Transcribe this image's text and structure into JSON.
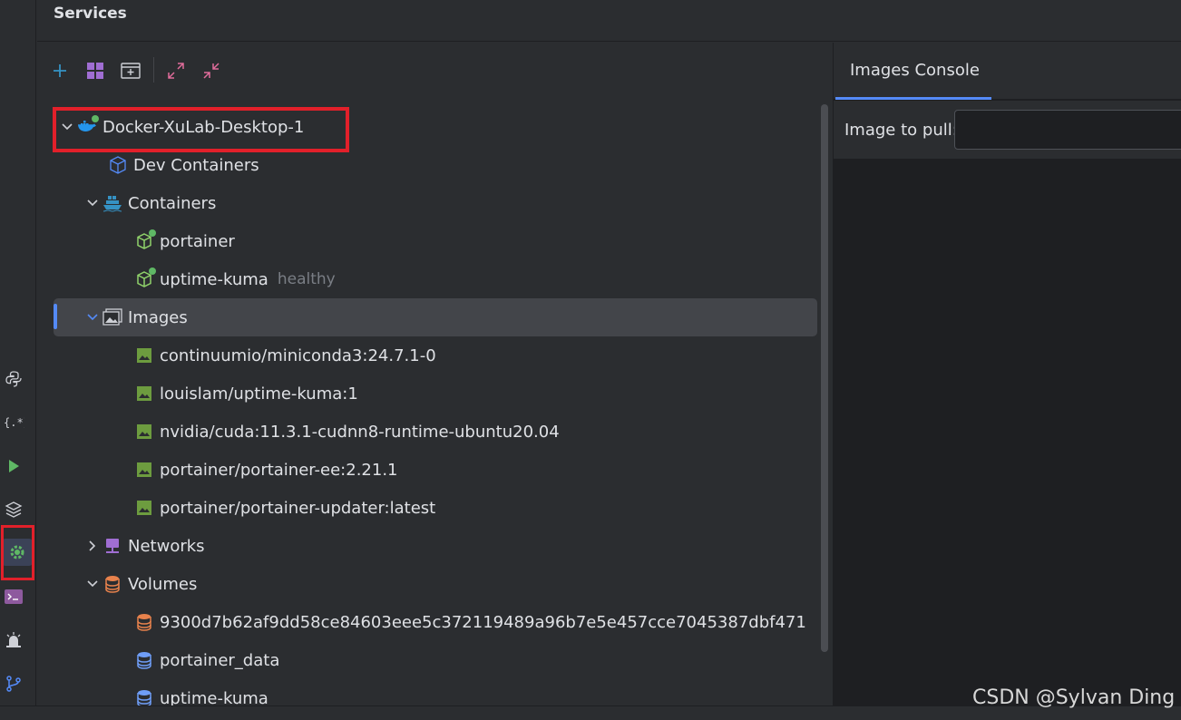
{
  "panel": {
    "title": "Services"
  },
  "toolbar": {
    "add": "add-icon",
    "group": "group-icon",
    "new_tab": "new-tab-icon",
    "expand": "expand-all-icon",
    "collapse": "collapse-all-icon"
  },
  "leftbar": {
    "items": [
      "python-icon",
      "regex-icon",
      "run-icon",
      "layers-icon",
      "services-gear-icon",
      "terminal-icon",
      "problems-icon",
      "git-icon"
    ],
    "active": "services-gear-icon"
  },
  "tree": {
    "root": {
      "label": "Docker-XuLab-Desktop-1",
      "status": "connected"
    },
    "dev_containers": {
      "label": "Dev Containers"
    },
    "containers": {
      "label": "Containers",
      "items": [
        {
          "label": "portainer",
          "hint": ""
        },
        {
          "label": "uptime-kuma",
          "hint": "healthy"
        }
      ]
    },
    "images": {
      "label": "Images",
      "items": [
        "continuumio/miniconda3:24.7.1-0",
        "louislam/uptime-kuma:1",
        "nvidia/cuda:11.3.1-cudnn8-runtime-ubuntu20.04",
        "portainer/portainer-ee:2.21.1",
        "portainer/portainer-updater:latest"
      ]
    },
    "networks": {
      "label": "Networks"
    },
    "volumes": {
      "label": "Volumes",
      "items": [
        "9300d7b62af9dd58ce84603eee5c372119489a96b7e5e457cce7045387dbf471",
        "portainer_data",
        "uptime-kuma"
      ]
    }
  },
  "console": {
    "tab": "Images Console",
    "pull_label": "Image to pull:",
    "pull_value": ""
  },
  "watermark": "CSDN @Sylvan Ding",
  "colors": {
    "accent": "#548af7",
    "highlight_box": "#e2202a",
    "healthy_dot": "#5fb865",
    "image_icon": "#6d9c3f",
    "volume_orange": "#e8824c",
    "volume_blue": "#6f9ef8"
  }
}
